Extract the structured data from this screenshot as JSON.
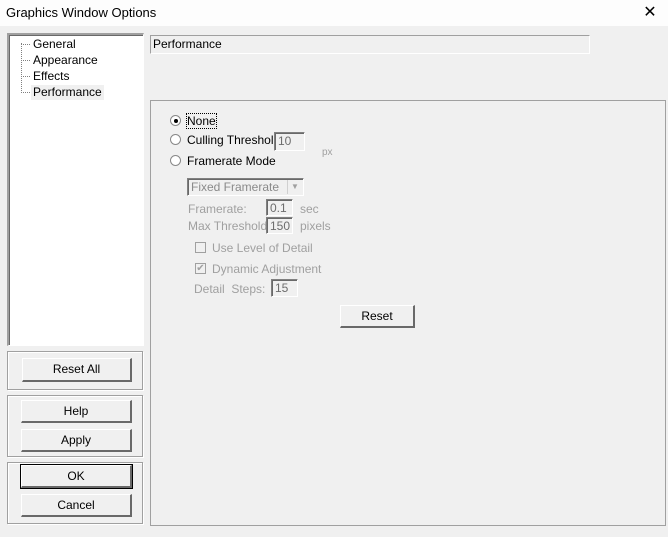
{
  "window": {
    "title": "Graphics Window Options",
    "close_icon": "close-icon"
  },
  "tree": {
    "items": [
      {
        "label": "General",
        "selected": false
      },
      {
        "label": "Appearance",
        "selected": false
      },
      {
        "label": "Effects",
        "selected": false
      },
      {
        "label": "Performance",
        "selected": true
      }
    ]
  },
  "buttons": {
    "reset_all": "Reset All",
    "help": "Help",
    "apply": "Apply",
    "ok": "OK",
    "cancel": "Cancel",
    "reset": "Reset"
  },
  "section_header": "Performance",
  "performance": {
    "options": [
      {
        "label": "None",
        "checked": true
      },
      {
        "label": "Culling Threshold",
        "checked": false
      },
      {
        "label": "Framerate Mode",
        "checked": false
      }
    ],
    "culling_threshold_value": "10",
    "culling_unit": "px",
    "framerate_mode_select": "Fixed Framerate",
    "framerate_label": "Framerate:",
    "framerate_value": "0.1",
    "framerate_unit": "sec",
    "max_threshold_label": "Max Threshold:",
    "max_threshold_value": "150",
    "max_threshold_unit": "pixels",
    "use_lod_label": "Use Level of Detail",
    "use_lod_checked": false,
    "dynamic_adjustment_label": "Dynamic Adjustment",
    "dynamic_adjustment_checked": true,
    "detail_steps_label": "Detail  Steps:",
    "detail_steps_value": "15"
  }
}
